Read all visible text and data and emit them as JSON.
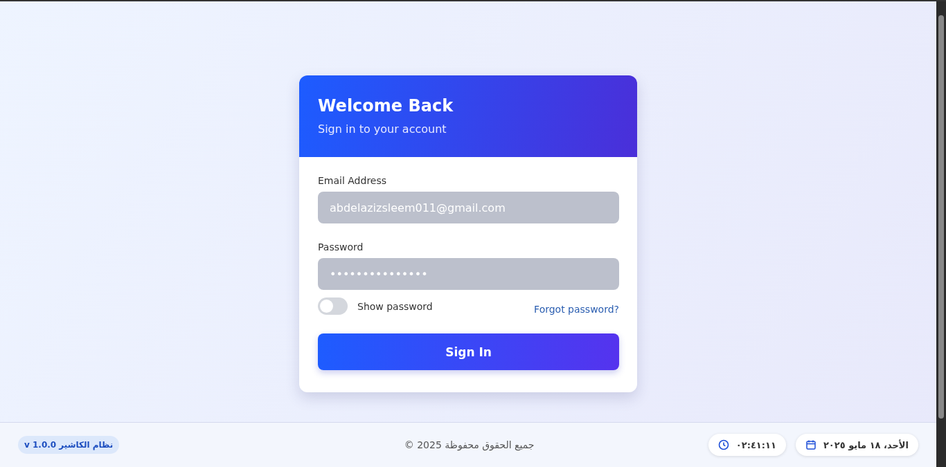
{
  "card": {
    "title": "Welcome Back",
    "subtitle": "Sign in to your account"
  },
  "email": {
    "label": "Email Address",
    "value": "abdelazizsleem011@gmail.com"
  },
  "password": {
    "label": "Password",
    "value": "•••••••••••••••"
  },
  "show_password": {
    "label": "Show password",
    "on": false
  },
  "forgot_link": "Forgot password?",
  "submit": "Sign In",
  "footer": {
    "version": "نظام الكاشير v 1.0.0",
    "copyright": "جميع الحقوق محفوظة 2025 ©",
    "time": "٠٢:٤١:١١",
    "date": "الأحد، ١٨ مايو ٢٠٢٥"
  }
}
